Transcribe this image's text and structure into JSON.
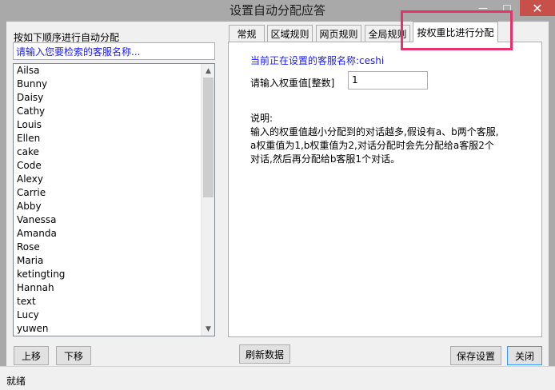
{
  "window": {
    "title": "设置自动分配应答",
    "minimize_glyph": "—",
    "maximize_glyph": "□",
    "close_glyph": "✕"
  },
  "left": {
    "heading": "按如下顺序进行自动分配",
    "search_placeholder": "请输入您要检索的客服名称...",
    "agents": [
      "Ailsa",
      "Bunny",
      "Daisy",
      "Cathy",
      "Louis",
      "Ellen",
      "cake",
      "Code",
      "Alexy",
      "Carrie",
      "Abby",
      "Vanessa",
      "Amanda",
      "Rose",
      "Maria",
      "ketingting",
      "Hannah",
      "text",
      "Lucy",
      "yuwen"
    ],
    "move_up": "上移",
    "move_down": "下移"
  },
  "tabs": [
    {
      "label": "常规"
    },
    {
      "label": "区域规则"
    },
    {
      "label": "网页规则"
    },
    {
      "label": "全局规则"
    },
    {
      "label": "按权重比进行分配",
      "active": true
    }
  ],
  "panel": {
    "current_agent": "当前正在设置的客服名称:ceshi",
    "weight_label": "请输入权重值[整数]",
    "weight_value": "1",
    "note_title": "说明:",
    "note_lines": [
      "输入的权重值越小分配到的对话越多,假设有a、b两个客服,",
      "a权重值为1,b权重值为2,对话分配时会先分配给a客服2个",
      "对话,然后再分配给b客服1个对话。"
    ]
  },
  "buttons": {
    "refresh": "刷新数据",
    "save": "保存设置",
    "close": "关闭"
  },
  "status": {
    "text": "就绪"
  },
  "colors": {
    "highlight": "#e8306b",
    "link_blue": "#1a1aff"
  },
  "icons": {
    "scroll_up": "▲",
    "scroll_down": "▼"
  }
}
